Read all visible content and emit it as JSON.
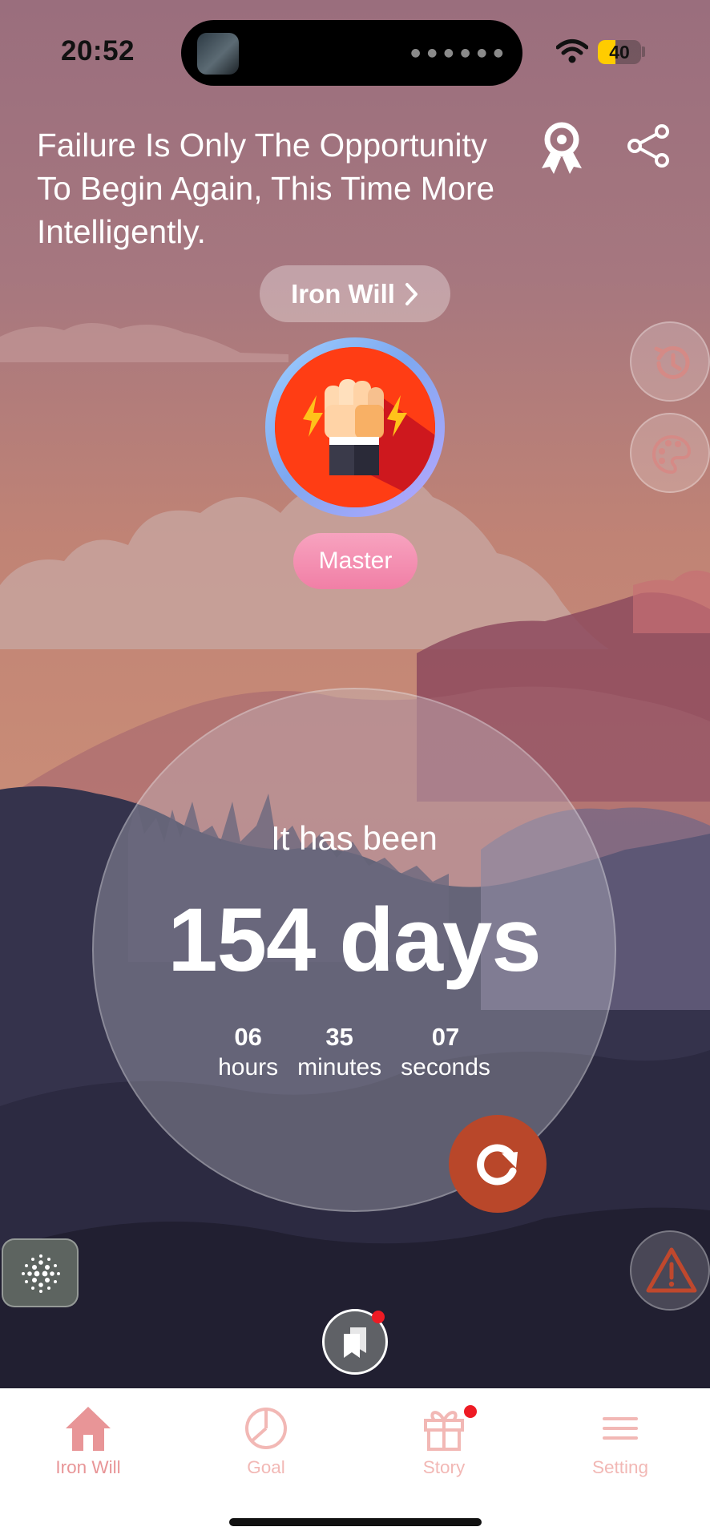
{
  "status_bar": {
    "time": "20:52",
    "battery_level": "40",
    "battery_fraction": 0.4
  },
  "header": {
    "quote": "Failure Is Only The Opportunity To Begin Again, This Time More Intelligently.",
    "badge_icon": "badge-icon",
    "share_icon": "share-icon"
  },
  "goal": {
    "name": "Iron Will",
    "chevron": "›"
  },
  "rank": {
    "label": "Master",
    "avatar_icon": "raised-fist-icon"
  },
  "side_buttons": [
    "history-icon",
    "palette-icon"
  ],
  "counter": {
    "heading": "It has been",
    "days_text": "154 days",
    "units": [
      {
        "value": "06",
        "label": "hours"
      },
      {
        "value": "35",
        "label": "minutes"
      },
      {
        "value": "07",
        "label": "seconds"
      }
    ]
  },
  "actions": {
    "reset_icon": "reset-icon",
    "alert_icon": "warning-icon",
    "sound_icon": "sound-dots-icon",
    "bookmark_icon": "bookmarks-icon"
  },
  "tabs": [
    {
      "label": "Iron Will",
      "icon": "home-icon",
      "active": true
    },
    {
      "label": "Goal",
      "icon": "pie-chart-icon",
      "active": false
    },
    {
      "label": "Story",
      "icon": "gift-icon",
      "active": false,
      "notification": true
    },
    {
      "label": "Setting",
      "icon": "menu-icon",
      "active": false
    }
  ],
  "colors": {
    "accent": "#b9472a",
    "tab_active": "#e89597",
    "tab_inactive": "#f2b8b5",
    "rank_pill": "#f17fa6",
    "notification_dot": "#ee1b24"
  }
}
